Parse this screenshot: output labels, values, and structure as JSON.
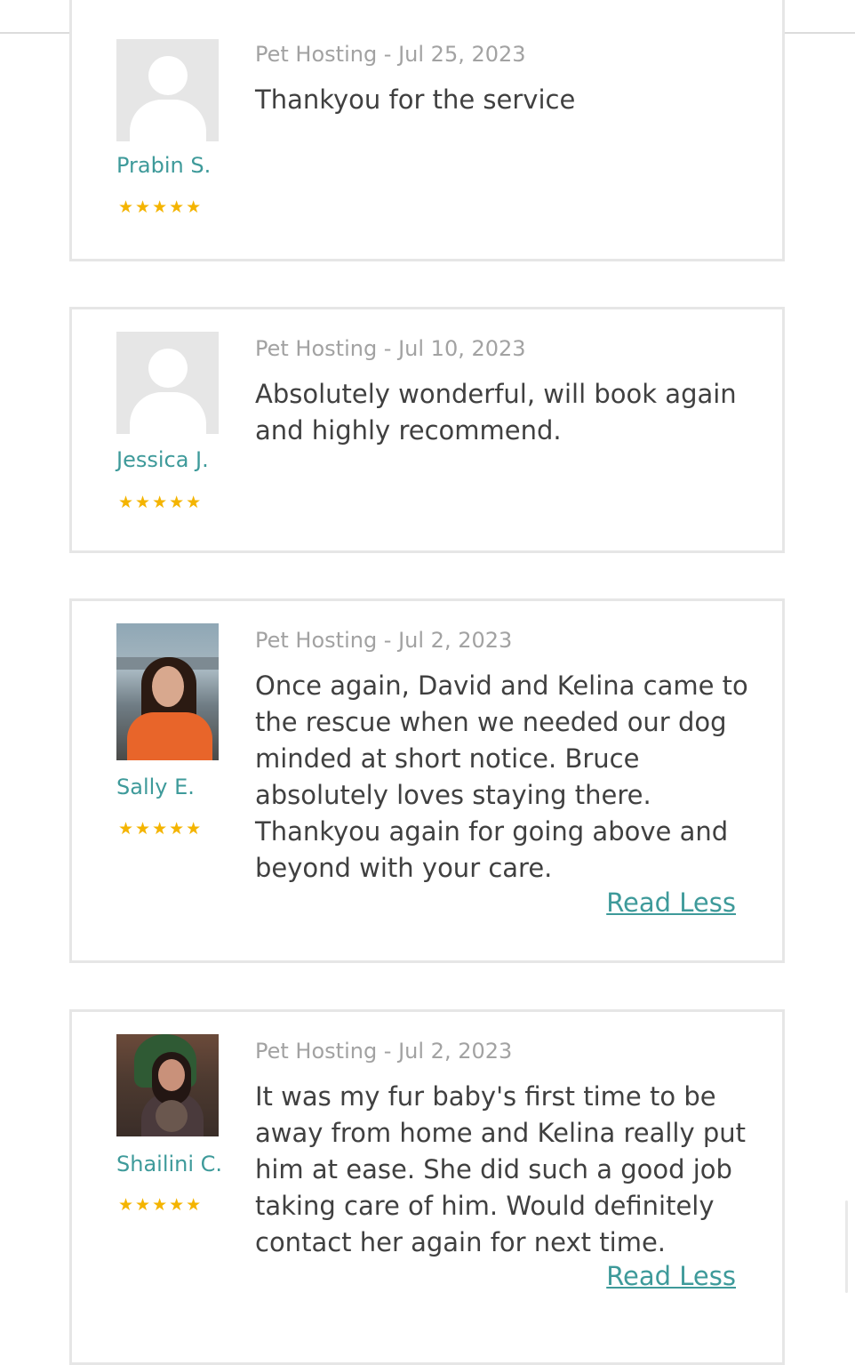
{
  "reviews": [
    {
      "reviewer": "Prabin S.",
      "avatar": "default-avatar-icon",
      "rating": 5,
      "stars": "★★★★★",
      "meta": "Pet Hosting - Jul 25, 2023",
      "text": "Thankyou for the service"
    },
    {
      "reviewer": "Jessica J.",
      "avatar": "default-avatar-icon",
      "rating": 5,
      "stars": "★★★★★",
      "meta": "Pet Hosting - Jul 10, 2023",
      "text": "Absolutely wonderful, will book again and highly recommend."
    },
    {
      "reviewer": "Sally E.",
      "avatar": "profile-photo",
      "rating": 5,
      "stars": "★★★★★",
      "meta": "Pet Hosting - Jul 2, 2023",
      "text": "Once again, David and Kelina came to the rescue when we needed our dog minded at short notice. Bruce absolutely loves staying there. Thankyou again for going above and beyond with your care.",
      "toggle_label": "Read Less"
    },
    {
      "reviewer": "Shailini C.",
      "avatar": "profile-photo",
      "rating": 5,
      "stars": "★★★★★",
      "meta": "Pet Hosting - Jul 2, 2023",
      "text": "It was my fur baby's first time to be away from home and Kelina really put him at ease. She did such a good job taking care of him. Would definitely contact her again for next time.",
      "toggle_label": "Read Less"
    }
  ],
  "colors": {
    "accent": "#3e9a9a",
    "star": "#f4b400",
    "meta": "#a2a2a2",
    "body_text": "#404040",
    "border": "#e6e6e6"
  }
}
